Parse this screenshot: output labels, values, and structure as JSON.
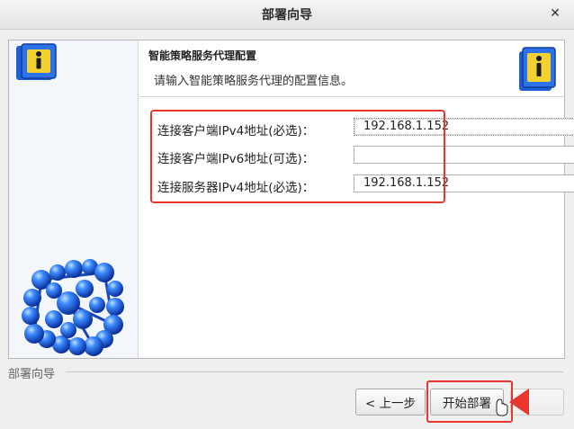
{
  "window": {
    "title": "部署向导"
  },
  "header": {
    "title": "智能策略服务代理配置",
    "description": "请输入智能策略服务代理的配置信息。"
  },
  "form": {
    "rows": [
      {
        "label": "连接客户端IPv4地址(必选)：",
        "value": "192.168.1.152"
      },
      {
        "label": "连接客户端IPv6地址(可选)：",
        "value": ""
      },
      {
        "label": "连接服务器IPv4地址(必选)：",
        "value": "192.168.1.152"
      }
    ]
  },
  "footer": {
    "group_label": "部署向导",
    "back_label": "< 上一步",
    "start_label": "开始部署",
    "next_label": ""
  },
  "colors": {
    "highlight": "#e8372e",
    "accent_blue": "#1f5fd6"
  },
  "icons": [
    "close-icon",
    "info-book-icon",
    "molecule-image",
    "mouse-cursor-icon",
    "red-arrow-icon"
  ]
}
